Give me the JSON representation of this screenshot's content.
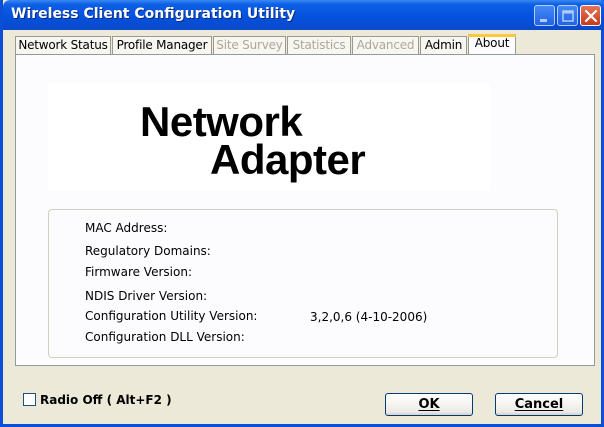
{
  "window": {
    "title": "Wireless Client Configuration Utility"
  },
  "title_buttons": {
    "minimize": "minimize-icon",
    "maximize": "maximize-icon",
    "close": "close-icon"
  },
  "tabs": [
    {
      "label": "Network Status",
      "enabled": true
    },
    {
      "label": "Profile Manager",
      "enabled": true
    },
    {
      "label": "Site Survey",
      "enabled": false
    },
    {
      "label": "Statistics",
      "enabled": false
    },
    {
      "label": "Advanced",
      "enabled": false
    },
    {
      "label": "Admin",
      "enabled": true
    },
    {
      "label": "About",
      "enabled": true,
      "selected": true
    }
  ],
  "about": {
    "logo_line1": "Network",
    "logo_line2": "Adapter",
    "fields": [
      {
        "label": "MAC Address:",
        "value": ""
      },
      {
        "label": "Regulatory Domains:",
        "value": ""
      },
      {
        "label": "Firmware Version:",
        "value": ""
      },
      {
        "label": "NDIS Driver Version:",
        "value": ""
      },
      {
        "label": "Configuration Utility Version:",
        "value": "3,2,0,6 (4-10-2006)"
      },
      {
        "label": "Configuration DLL Version:",
        "value": ""
      }
    ]
  },
  "footer": {
    "radio_off_label": "Radio Off  ( Alt+F2 )",
    "radio_off_checked": false,
    "ok_label": "OK",
    "cancel_label": "Cancel"
  },
  "colors": {
    "titlebar": "#0550dc",
    "window_bg": "#ece9d8",
    "tab_active_accent": "#ffc73c",
    "disabled_text": "#aca899"
  }
}
